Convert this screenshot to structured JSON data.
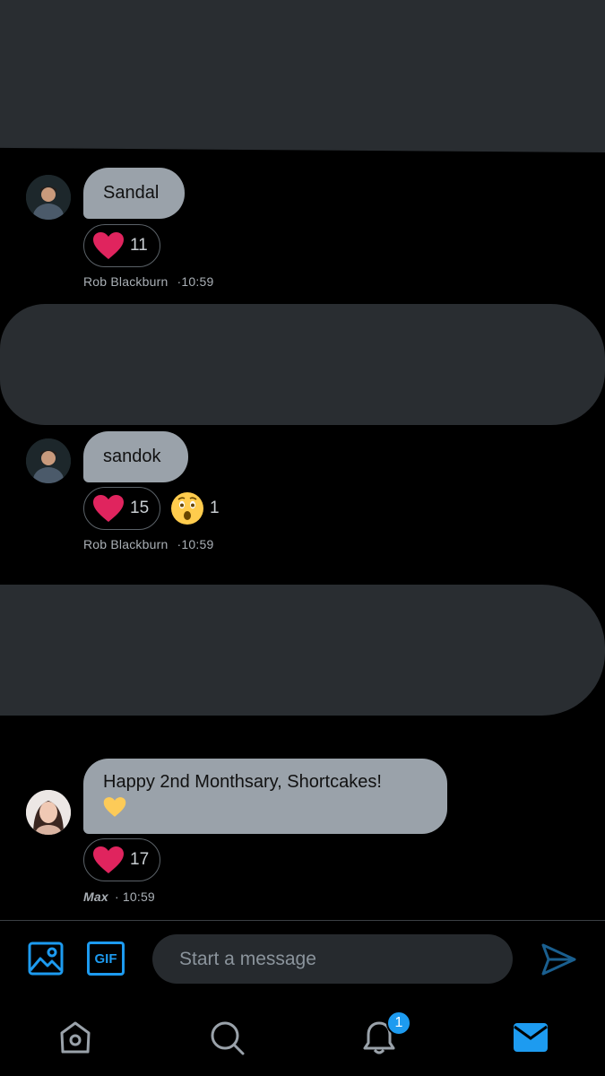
{
  "messages": [
    {
      "text": "Sandal",
      "reactions": [
        {
          "emoji": "heart",
          "count": "11"
        }
      ],
      "author": "Rob Blackburn",
      "time": "·10:59"
    },
    {
      "text": "sandok",
      "reactions": [
        {
          "emoji": "heart",
          "count": "15"
        },
        {
          "emoji": "astonished",
          "count": "1"
        }
      ],
      "author": "Rob Blackburn",
      "time": "·10:59"
    },
    {
      "text": "Happy 2nd Monthsary, Shortcakes!",
      "emoji": "yellow-heart",
      "reactions": [
        {
          "emoji": "heart",
          "count": "17"
        }
      ],
      "author": "Max",
      "time": "· 10:59"
    }
  ],
  "composer": {
    "placeholder": "Start a message"
  },
  "toolbar": {
    "gif_label": "GIF"
  },
  "nav": {
    "notifications_badge": "1"
  },
  "colors": {
    "accent": "#1d9bf0",
    "bubble": "#9aa2aa",
    "background": "#000000",
    "redaction": "#292d31"
  }
}
